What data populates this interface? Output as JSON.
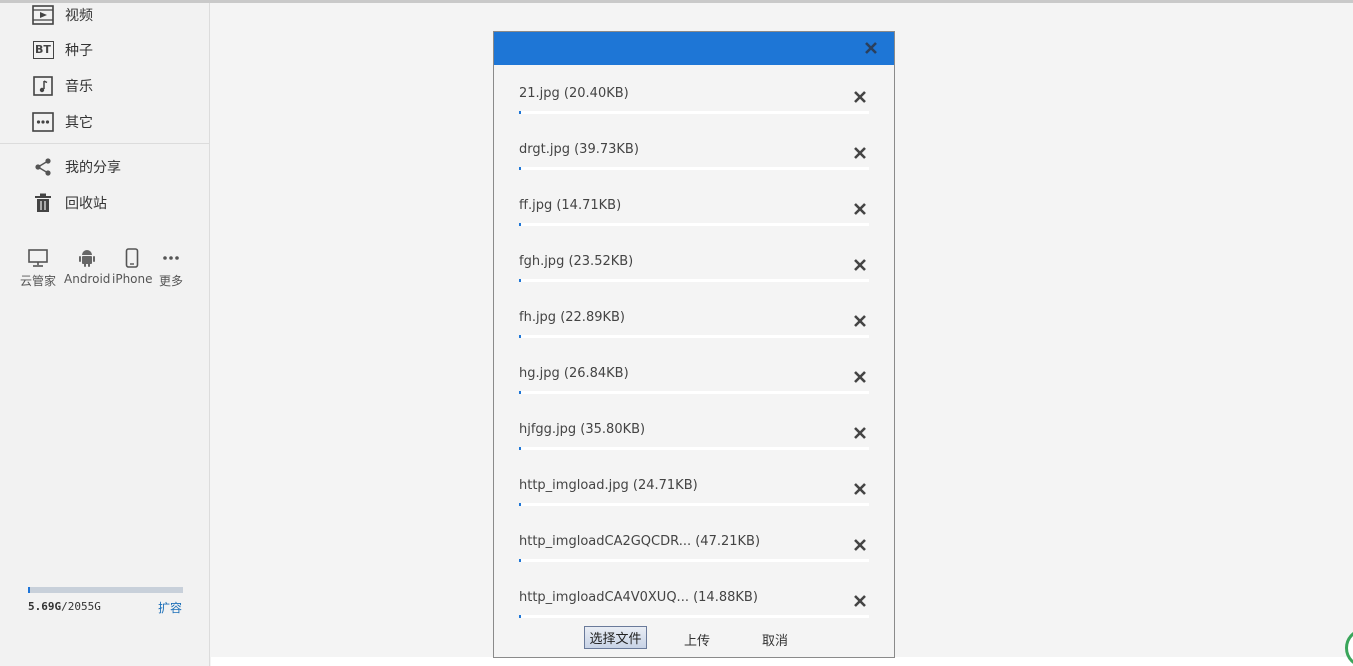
{
  "sidebar": {
    "nav_items": [
      {
        "label": "视频",
        "icon": "video-icon"
      },
      {
        "label": "种子",
        "icon": "bt-icon",
        "icon_text": "BT"
      },
      {
        "label": "音乐",
        "icon": "music-icon"
      },
      {
        "label": "其它",
        "icon": "more-icon"
      },
      {
        "label": "我的分享",
        "icon": "share-icon"
      },
      {
        "label": "回收站",
        "icon": "trash-icon"
      }
    ],
    "devices": [
      {
        "label": "云管家",
        "icon": "monitor-icon"
      },
      {
        "label": "Android",
        "icon": "android-icon"
      },
      {
        "label": "iPhone",
        "icon": "phone-icon"
      },
      {
        "label": "更多",
        "icon": "ellipsis-icon"
      }
    ],
    "quota": {
      "used": "5.69G",
      "total": "/2055G",
      "expand_label": "扩容",
      "used_fraction": 0.003
    }
  },
  "dialog": {
    "files": [
      {
        "name": "21.jpg (20.40KB)",
        "progress": 0.005
      },
      {
        "name": "drgt.jpg (39.73KB)",
        "progress": 0.005
      },
      {
        "name": "ff.jpg (14.71KB)",
        "progress": 0.005
      },
      {
        "name": "fgh.jpg (23.52KB)",
        "progress": 0.005
      },
      {
        "name": "fh.jpg (22.89KB)",
        "progress": 0.005
      },
      {
        "name": "hg.jpg (26.84KB)",
        "progress": 0.005
      },
      {
        "name": "hjfgg.jpg (35.80KB)",
        "progress": 0.005
      },
      {
        "name": "http_imgload.jpg (24.71KB)",
        "progress": 0.005
      },
      {
        "name": "http_imgloadCA2GQCDR... (47.21KB)",
        "progress": 0.005
      },
      {
        "name": "http_imgloadCA4V0XUQ... (14.88KB)",
        "progress": 0.005
      }
    ],
    "choose_label": "选择文件",
    "upload_label": "上传",
    "cancel_label": "取消"
  },
  "colors": {
    "header": "#1e76d6",
    "link": "#1d6fb8"
  }
}
